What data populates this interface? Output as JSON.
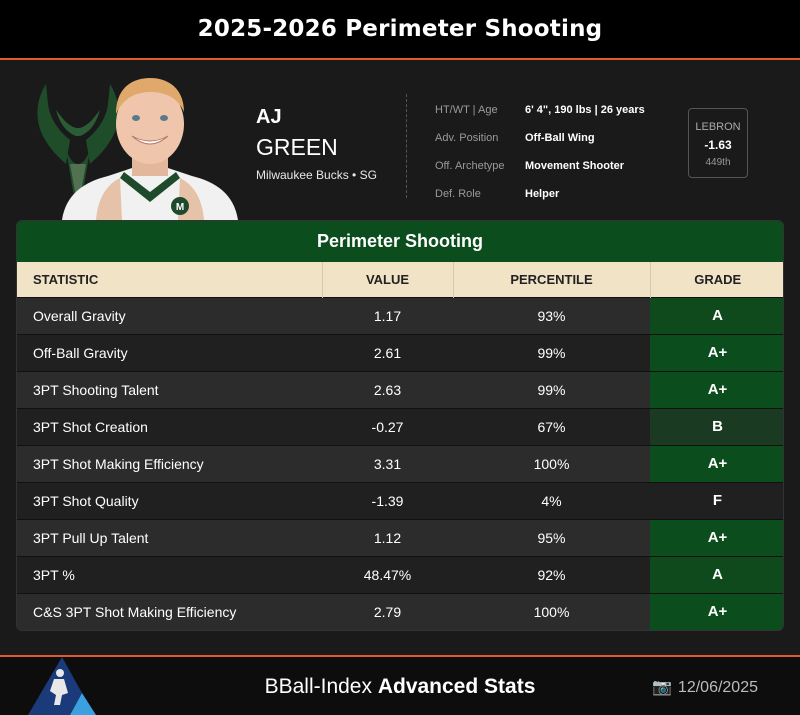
{
  "title": "2025-2026 Perimeter Shooting",
  "player": {
    "first_name": "AJ",
    "last_name": "GREEN",
    "team_position": "Milwaukee Bucks • SG",
    "jersey_logo": "M"
  },
  "info": [
    {
      "label": "HT/WT | Age",
      "value": "6' 4\", 190 lbs | 26 years"
    },
    {
      "label": "Adv. Position",
      "value": "Off-Ball Wing"
    },
    {
      "label": "Off. Archetype",
      "value": "Movement Shooter"
    },
    {
      "label": "Def. Role",
      "value": "Helper"
    }
  ],
  "lebron": {
    "label": "LEBRON",
    "value": "-1.63",
    "rank": "449th"
  },
  "table": {
    "title": "Perimeter Shooting",
    "headers": [
      "STATISTIC",
      "VALUE",
      "PERCENTILE",
      "GRADE"
    ],
    "rows": [
      {
        "stat": "Overall Gravity",
        "value": "1.17",
        "percentile": "93%",
        "grade": "A",
        "grade_color": "#0e4a1c"
      },
      {
        "stat": "Off-Ball Gravity",
        "value": "2.61",
        "percentile": "99%",
        "grade": "A+",
        "grade_color": "#0b4d1c"
      },
      {
        "stat": "3PT Shooting Talent",
        "value": "2.63",
        "percentile": "99%",
        "grade": "A+",
        "grade_color": "#0b4d1c"
      },
      {
        "stat": "3PT Shot Creation",
        "value": "-0.27",
        "percentile": "67%",
        "grade": "B",
        "grade_color": "#1a3a22"
      },
      {
        "stat": "3PT Shot Making Efficiency",
        "value": "3.31",
        "percentile": "100%",
        "grade": "A+",
        "grade_color": "#0b4d1c"
      },
      {
        "stat": "3PT Shot Quality",
        "value": "-1.39",
        "percentile": "4%",
        "grade": "F",
        "grade_color": "#202020"
      },
      {
        "stat": "3PT Pull Up Talent",
        "value": "1.12",
        "percentile": "95%",
        "grade": "A+",
        "grade_color": "#0b4d1c"
      },
      {
        "stat": "3PT %",
        "value": "48.47%",
        "percentile": "92%",
        "grade": "A",
        "grade_color": "#0e4a1c"
      },
      {
        "stat": "C&S 3PT Shot Making Efficiency",
        "value": "2.79",
        "percentile": "100%",
        "grade": "A+",
        "grade_color": "#0b4d1c"
      }
    ]
  },
  "footer": {
    "brand_regular": "BBall-Index ",
    "brand_bold": "Advanced Stats",
    "date": "12/06/2025"
  },
  "colors": {
    "accent": "#e05a2a",
    "header_green": "#0b4d1c",
    "table_header": "#f0e3c6"
  },
  "icons": [
    "bucks-logo-icon",
    "camera-icon",
    "bball-index-logo-icon"
  ]
}
